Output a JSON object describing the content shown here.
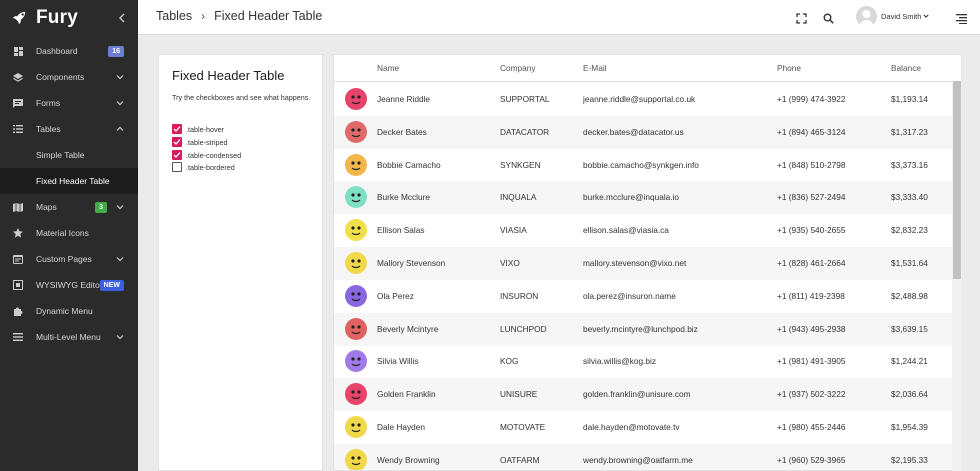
{
  "brand": {
    "name": "Fury",
    "collapse_icon": "chevron-left-icon"
  },
  "sidebar": {
    "items": [
      {
        "label": "Dashboard",
        "icon": "dashboard-icon",
        "badge": "16"
      },
      {
        "label": "Components",
        "icon": "layers-icon",
        "chevron": true
      },
      {
        "label": "Forms",
        "icon": "forms-icon",
        "chevron": true
      },
      {
        "label": "Tables",
        "icon": "list-icon",
        "chevron": true,
        "expanded": true
      },
      {
        "label": "Maps",
        "icon": "map-icon",
        "badge": "3",
        "chevron": true
      },
      {
        "label": "Material Icons",
        "icon": "star-icon"
      },
      {
        "label": "Custom Pages",
        "icon": "pages-icon",
        "chevron": true
      },
      {
        "label": "WYSIWYG Editor",
        "icon": "editor-icon",
        "badge": "NEW"
      },
      {
        "label": "Dynamic Menu",
        "icon": "puzzle-icon"
      },
      {
        "label": "Multi-Level Menu",
        "icon": "menu-icon",
        "chevron": true
      }
    ],
    "tables_sub": [
      {
        "label": "Simple Table"
      },
      {
        "label": "Fixed Header Table",
        "active": true
      }
    ]
  },
  "header": {
    "breadcrumb": [
      "Tables",
      "Fixed Header Table"
    ],
    "user_name": "David Smith"
  },
  "options_card": {
    "title": "Fixed Header Table",
    "description": "Try the checkboxes and see what happens.",
    "options": [
      {
        "label": ".table-hover",
        "checked": true
      },
      {
        "label": ".table-striped",
        "checked": true
      },
      {
        "label": ".table-condensed",
        "checked": true
      },
      {
        "label": ".table-bordered",
        "checked": false
      }
    ]
  },
  "table": {
    "columns": [
      "Name",
      "Company",
      "E-Mail",
      "Phone",
      "Balance"
    ],
    "rows": [
      {
        "name": "Jeanne Riddle",
        "company": "SUPPORTAL",
        "email": "jeanne.riddle@supportal.co.uk",
        "phone": "+1 (999) 474-3922",
        "balance": "$1,193.14",
        "avatar_color": "#e8436a"
      },
      {
        "name": "Decker Bates",
        "company": "DATACATOR",
        "email": "decker.bates@datacator.us",
        "phone": "+1 (894) 465-3124",
        "balance": "$1,317.23",
        "avatar_color": "#e06a6a"
      },
      {
        "name": "Bobbie Camacho",
        "company": "SYNKGEN",
        "email": "bobbie.camacho@synkgen.info",
        "phone": "+1 (848) 510-2798",
        "balance": "$3,373.16",
        "avatar_color": "#f2b64a"
      },
      {
        "name": "Burke Mcclure",
        "company": "INQUALA",
        "email": "burke.mcclure@inquala.io",
        "phone": "+1 (836) 527-2494",
        "balance": "$3,333.40",
        "avatar_color": "#7fe0c4"
      },
      {
        "name": "Ellison Salas",
        "company": "VIASIA",
        "email": "ellison.salas@viasia.ca",
        "phone": "+1 (935) 540-2655",
        "balance": "$2,832.23",
        "avatar_color": "#f0e04a"
      },
      {
        "name": "Mallory Stevenson",
        "company": "VIXO",
        "email": "mallory.stevenson@vixo.net",
        "phone": "+1 (828) 461-2664",
        "balance": "$1,531.64",
        "avatar_color": "#f0d84a"
      },
      {
        "name": "Ola Perez",
        "company": "INSURON",
        "email": "ola.perez@insuron.name",
        "phone": "+1 (811) 419-2398",
        "balance": "$2,488.98",
        "avatar_color": "#8a66e0"
      },
      {
        "name": "Beverly Mcintyre",
        "company": "LUNCHPOD",
        "email": "beverly.mcintyre@lunchpod.biz",
        "phone": "+1 (943) 495-2938",
        "balance": "$3,639.15",
        "avatar_color": "#e06262"
      },
      {
        "name": "Silvia Willis",
        "company": "KOG",
        "email": "silvia.willis@kog.biz",
        "phone": "+1 (981) 491-3905",
        "balance": "$1,244.21",
        "avatar_color": "#a07ae8"
      },
      {
        "name": "Golden Franklin",
        "company": "UNISURE",
        "email": "golden.franklin@unisure.com",
        "phone": "+1 (937) 502-3222",
        "balance": "$2,036.64",
        "avatar_color": "#e8436a"
      },
      {
        "name": "Dale Hayden",
        "company": "MOTOVATE",
        "email": "dale.hayden@motovate.tv",
        "phone": "+1 (980) 455-2446",
        "balance": "$1,954.39",
        "avatar_color": "#f0d84a"
      },
      {
        "name": "Wendy Browning",
        "company": "OATFARM",
        "email": "wendy.browning@oatfarm.me",
        "phone": "+1 (960) 529-3965",
        "balance": "$2,195.33",
        "avatar_color": "#f0d84a"
      }
    ]
  }
}
